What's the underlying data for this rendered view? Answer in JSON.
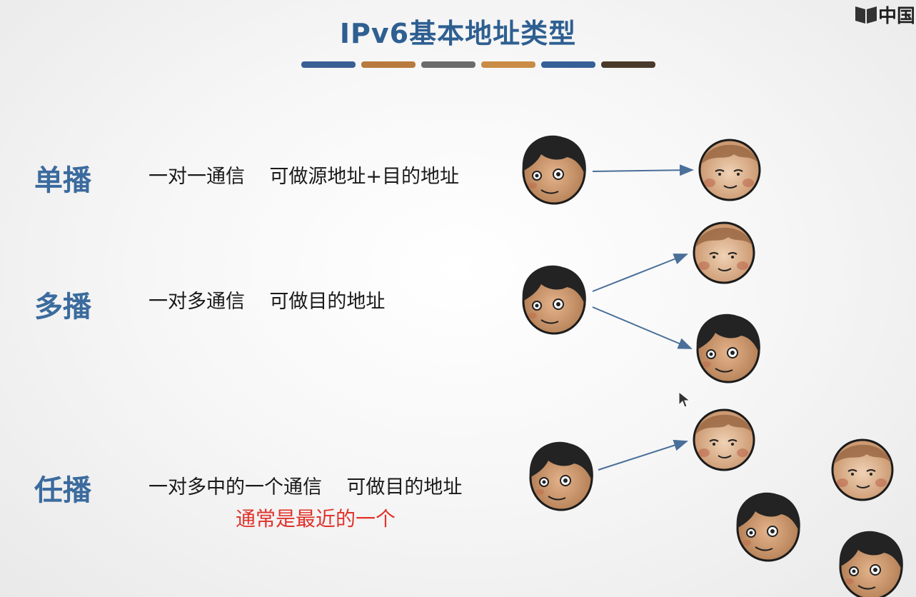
{
  "slide": {
    "title": "IPv6基本地址类型",
    "logo_text": "中国",
    "color_bars": [
      "#3a5f95",
      "#b87a3d",
      "#6b6b6b",
      "#c98b45",
      "#365f98",
      "#4a3a2b"
    ]
  },
  "rows": [
    {
      "title": "单播",
      "description": "一对一通信    可做源地址+目的地址"
    },
    {
      "title": "多播",
      "description": "一对多通信    可做目的地址"
    },
    {
      "title": "任播",
      "description": "一对多中的一个通信    可做目的地址",
      "note": "通常是最近的一个"
    }
  ],
  "colors": {
    "title_blue": "#2e5f91",
    "row_title_blue": "#3b6b9e",
    "note_red": "#e0332b",
    "arrow": "#4a6f99"
  },
  "icons": [
    "dark-haired-person-icon",
    "light-haired-person-icon",
    "mouse-cursor-icon",
    "book-logo-icon"
  ]
}
